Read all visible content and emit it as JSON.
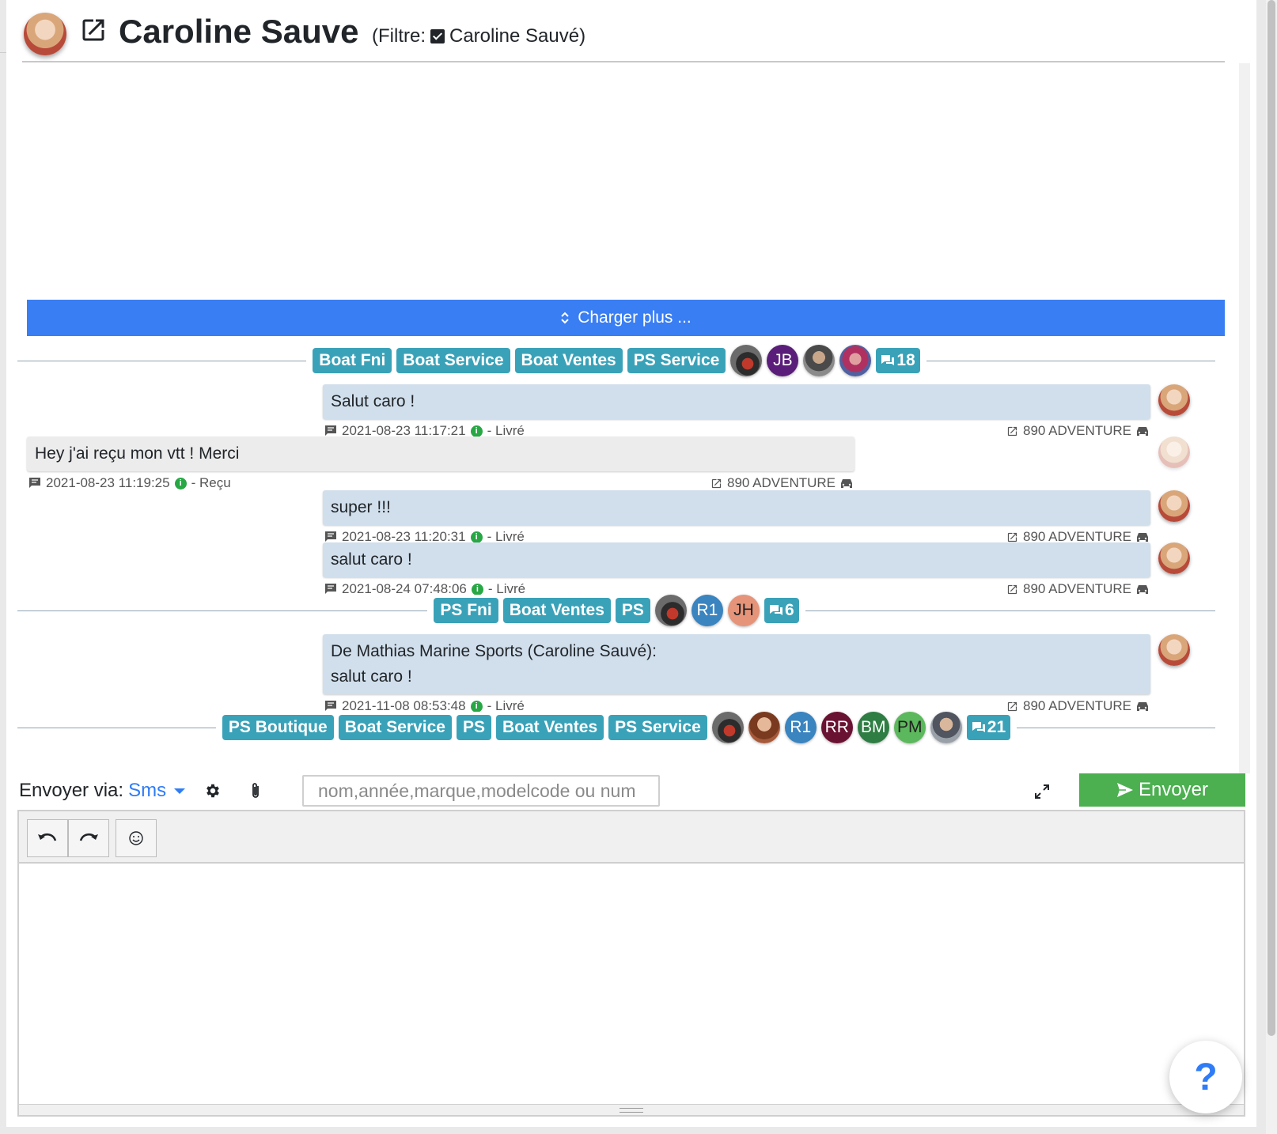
{
  "header": {
    "title": "Caroline Sauve",
    "filter_prefix": "(Filtre:",
    "filter_name": "Caroline Sauvé)"
  },
  "load_more": {
    "label": "Charger plus ..."
  },
  "groups": [
    {
      "tags": [
        "Boat Fni",
        "Boat Service",
        "Boat Ventes",
        "PS Service"
      ],
      "initials": [
        "JB"
      ],
      "count": "18"
    },
    {
      "tags": [
        "PS Fni",
        "Boat Ventes",
        "PS"
      ],
      "initials": [
        "R1",
        "JH"
      ],
      "count": "6"
    },
    {
      "tags": [
        "PS Boutique",
        "Boat Service",
        "PS",
        "Boat Ventes",
        "PS Service"
      ],
      "initials": [
        "R1",
        "RR",
        "BM",
        "PM"
      ],
      "count": "21"
    }
  ],
  "avatar_colors": {
    "JB": "#5a1e7a",
    "R1": "#3a84c0",
    "JH": "#e5947a",
    "RR": "#6a1232",
    "BM": "#2e7d42",
    "PM": "#5cb85c"
  },
  "messages": [
    {
      "text": "Salut caro !",
      "timestamp": "2021-08-23 11:17:21",
      "status": "- Livré",
      "vehicle": "890 ADVENTURE"
    },
    {
      "text": "Hey j'ai reçu mon vtt ! Merci",
      "timestamp": "2021-08-23 11:19:25",
      "status": "- Reçu",
      "vehicle": "890 ADVENTURE"
    },
    {
      "text": "super !!!",
      "timestamp": "2021-08-23 11:20:31",
      "status": "- Livré",
      "vehicle": "890 ADVENTURE"
    },
    {
      "text": "salut caro !",
      "timestamp": "2021-08-24 07:48:06",
      "status": "- Livré",
      "vehicle": "890 ADVENTURE"
    },
    {
      "text_line1": "De Mathias Marine Sports (Caroline Sauvé):",
      "text_line2": "salut caro !",
      "timestamp": "2021-11-08 08:53:48",
      "status": "- Livré",
      "vehicle": "890 ADVENTURE"
    }
  ],
  "composer": {
    "send_via_label": "Envoyer via:",
    "channel": "Sms",
    "vehicle_placeholder": "nom,année,marque,modelcode ou num",
    "send_label": "Envoyer"
  },
  "help": {
    "label": "?"
  },
  "colors": {
    "primary": "#3a7ef4",
    "tag": "#3aa2b8",
    "send": "#4caf50",
    "outgoing": "#d1dfec",
    "incoming": "#ececec"
  }
}
